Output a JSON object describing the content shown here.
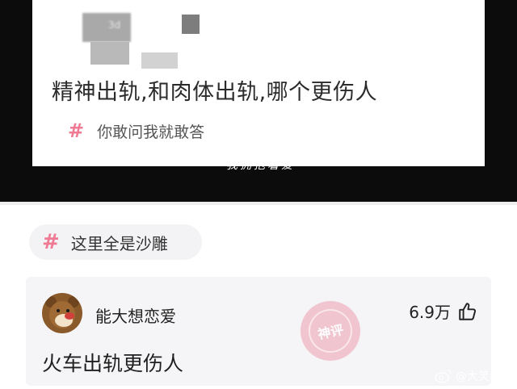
{
  "screenshot": {
    "question": "精神出轨,和肉体出轨,哪个更伤人",
    "topic_tag": "你敢问我就敢答",
    "blur_text": "3d"
  },
  "caption": "“我拥抱着爱”",
  "tag_chip": {
    "label": "这里全是沙雕"
  },
  "comment": {
    "username": "能大想恋爱",
    "likes": "6.9万",
    "text": "火车出轨更伤人",
    "stamp_label": "神评"
  },
  "watermark": {
    "handle": "@大笑酱"
  },
  "colors": {
    "accent_pink": "#f07a93",
    "card_bg": "#f5f5f7",
    "chip_bg": "#f3f3f5",
    "frame_dark": "#0c0c0c"
  },
  "icons": {
    "tag": "hash-icon",
    "like": "thumbs-up-icon",
    "stamp": "stamp-icon",
    "avatar": "bear-avatar",
    "weibo": "weibo-icon"
  }
}
